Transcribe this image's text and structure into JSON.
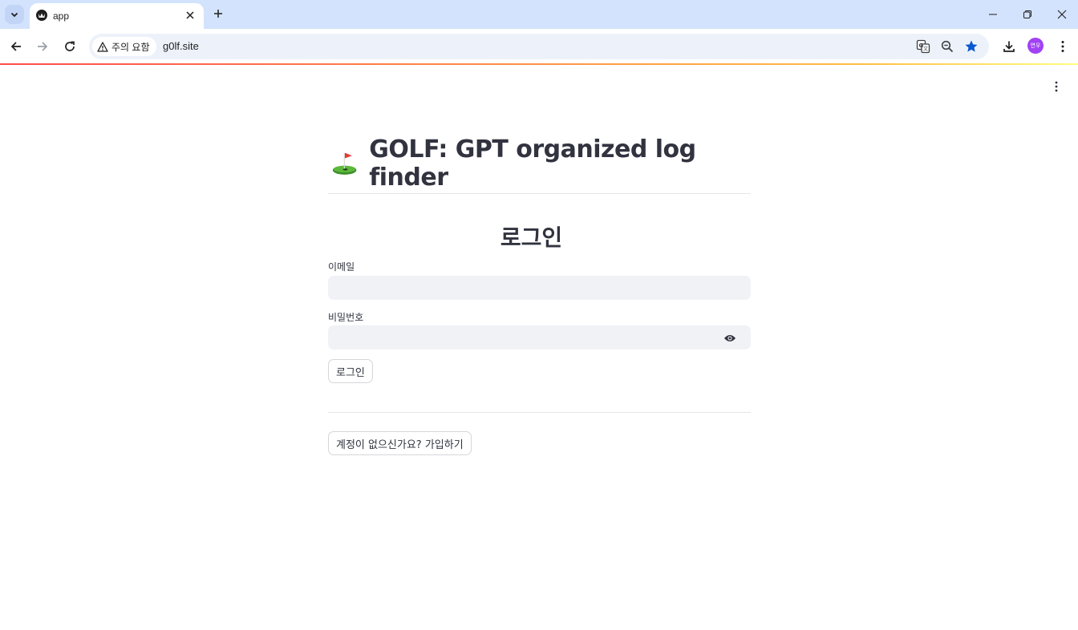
{
  "browser": {
    "tab": {
      "title": "app"
    },
    "security_chip": "주의 요함",
    "url": "g0lf.site",
    "avatar_text": "연우",
    "accent": "#1a73e8"
  },
  "app": {
    "title": "GOLF: GPT organized log finder",
    "title_icon": "golf-flag-emoji",
    "login": {
      "heading": "로그인",
      "email_label": "이메일",
      "email_value": "",
      "password_label": "비밀번호",
      "password_value": "",
      "login_button": "로그인",
      "signup_button": "계정이 없으신가요? 가입하기"
    }
  }
}
